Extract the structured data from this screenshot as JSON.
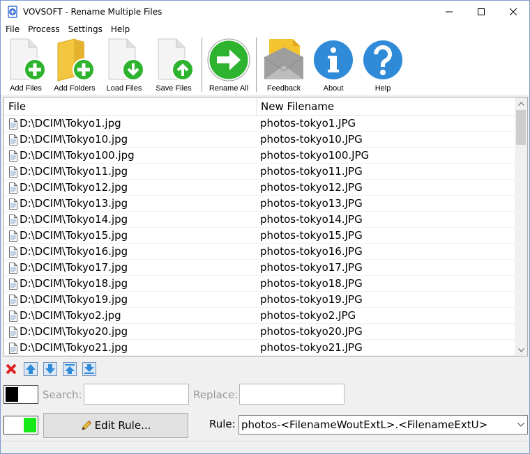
{
  "window": {
    "title": "VOVSOFT - Rename Multiple Files",
    "controls": [
      "minimize",
      "maximize",
      "close"
    ]
  },
  "menu": [
    "File",
    "Process",
    "Settings",
    "Help"
  ],
  "toolbar": {
    "add_files": "Add Files",
    "add_folders": "Add Folders",
    "load_files": "Load Files",
    "save_files": "Save Files",
    "rename_all": "Rename All",
    "feedback": "Feedback",
    "about": "About",
    "help": "Help"
  },
  "list": {
    "columns": [
      "File",
      "New Filename"
    ],
    "rows": [
      [
        "D:\\DCIM\\Tokyo1.jpg",
        "photos-tokyo1.JPG"
      ],
      [
        "D:\\DCIM\\Tokyo10.jpg",
        "photos-tokyo10.JPG"
      ],
      [
        "D:\\DCIM\\Tokyo100.jpg",
        "photos-tokyo100.JPG"
      ],
      [
        "D:\\DCIM\\Tokyo11.jpg",
        "photos-tokyo11.JPG"
      ],
      [
        "D:\\DCIM\\Tokyo12.jpg",
        "photos-tokyo12.JPG"
      ],
      [
        "D:\\DCIM\\Tokyo13.jpg",
        "photos-tokyo13.JPG"
      ],
      [
        "D:\\DCIM\\Tokyo14.jpg",
        "photos-tokyo14.JPG"
      ],
      [
        "D:\\DCIM\\Tokyo15.jpg",
        "photos-tokyo15.JPG"
      ],
      [
        "D:\\DCIM\\Tokyo16.jpg",
        "photos-tokyo16.JPG"
      ],
      [
        "D:\\DCIM\\Tokyo17.jpg",
        "photos-tokyo17.JPG"
      ],
      [
        "D:\\DCIM\\Tokyo18.jpg",
        "photos-tokyo18.JPG"
      ],
      [
        "D:\\DCIM\\Tokyo19.jpg",
        "photos-tokyo19.JPG"
      ],
      [
        "D:\\DCIM\\Tokyo2.jpg",
        "photos-tokyo2.JPG"
      ],
      [
        "D:\\DCIM\\Tokyo20.jpg",
        "photos-tokyo20.JPG"
      ],
      [
        "D:\\DCIM\\Tokyo21.jpg",
        "photos-tokyo21.JPG"
      ]
    ]
  },
  "search": {
    "search_label": "Search:",
    "search_value": "",
    "replace_label": "Replace:",
    "replace_value": ""
  },
  "rule": {
    "edit_button": "Edit Rule...",
    "label": "Rule:",
    "value": "photos-<FilenameWoutExtL>.<FilenameExtU>"
  },
  "colors": {
    "green": "#2db32d",
    "blue": "#2f8ad8",
    "yellow": "#f4c430",
    "toggle_on": "#17e817"
  }
}
